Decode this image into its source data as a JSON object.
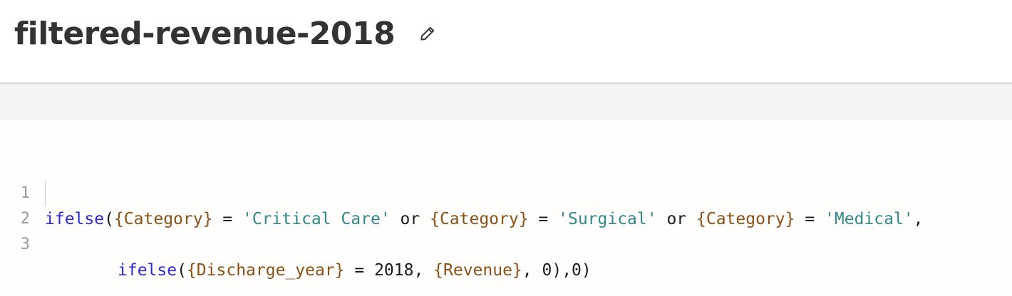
{
  "header": {
    "title": "filtered-revenue-2018",
    "edit_icon": "pencil-icon"
  },
  "colors": {
    "function": "#2a2ad6",
    "field": "#8a5217",
    "string": "#2f8a8a",
    "plain": "#1a1a1a",
    "line_number": "#9a9a9a"
  },
  "editor": {
    "lines": [
      {
        "number": "1",
        "tokens": [
          {
            "type": "fn",
            "text": "ifelse"
          },
          {
            "type": "op",
            "text": "("
          },
          {
            "type": "field",
            "text": "{Category}"
          },
          {
            "type": "op",
            "text": " = "
          },
          {
            "type": "str",
            "text": "'Critical Care'"
          },
          {
            "type": "kw",
            "text": " or "
          },
          {
            "type": "field",
            "text": "{Category}"
          },
          {
            "type": "op",
            "text": " = "
          },
          {
            "type": "str",
            "text": "'Surgical'"
          },
          {
            "type": "kw",
            "text": " or "
          },
          {
            "type": "field",
            "text": "{Category}"
          },
          {
            "type": "op",
            "text": " = "
          },
          {
            "type": "str",
            "text": "'Medical'"
          },
          {
            "type": "op",
            "text": ","
          }
        ]
      },
      {
        "number": "2",
        "tokens": [
          {
            "type": "fn",
            "text": "ifelse"
          },
          {
            "type": "op",
            "text": "("
          },
          {
            "type": "field",
            "text": "{Discharge_year}"
          },
          {
            "type": "op",
            "text": " = "
          },
          {
            "type": "num",
            "text": "2018"
          },
          {
            "type": "op",
            "text": ", "
          },
          {
            "type": "field",
            "text": "{Revenue}"
          },
          {
            "type": "op",
            "text": ", "
          },
          {
            "type": "num",
            "text": "0"
          },
          {
            "type": "op",
            "text": "),"
          },
          {
            "type": "num",
            "text": "0"
          },
          {
            "type": "op",
            "text": ")"
          }
        ]
      },
      {
        "number": "3",
        "tokens": []
      }
    ]
  }
}
